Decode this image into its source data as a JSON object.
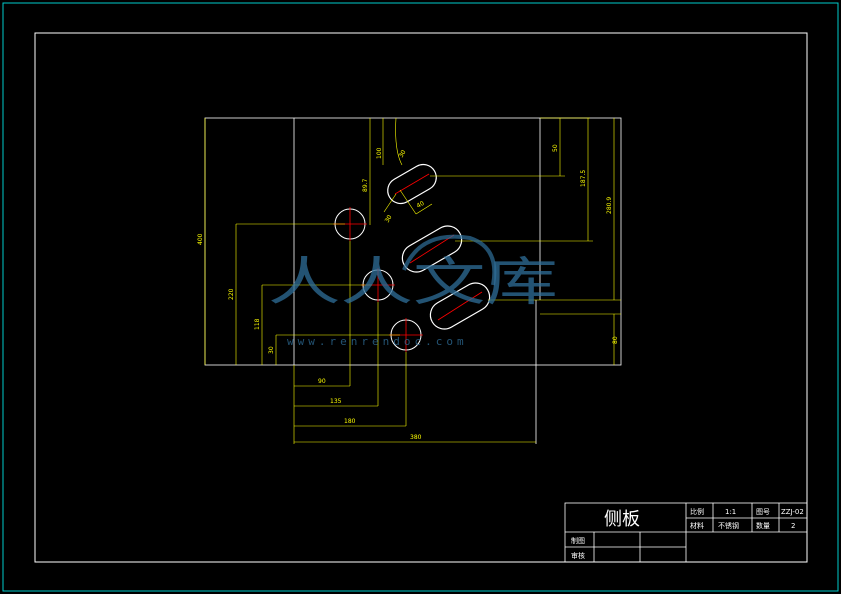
{
  "colors": {
    "background": "#000000",
    "sheet_border": "#00cccc",
    "frame": "#ffffff",
    "part_outline": "#ffffff",
    "dimension": "#ffff00",
    "centerline": "#ff0000",
    "watermark": "#2f6f9a"
  },
  "dimensions": {
    "overall_height": "400",
    "height_hole1": "220",
    "height_hole2": "118",
    "height_hole3": "30",
    "width_hole1": "90",
    "width_hole2": "135",
    "width_hole3": "180",
    "overall_width": "380",
    "top_right_small": "50",
    "top_right_mid": "187.5",
    "right_overall": "280.9",
    "right_bottom": "80",
    "slot_height": "89.7",
    "slot_offset": "100",
    "slot_angle": "30",
    "slot_width": "40"
  },
  "title_block": {
    "part_name": "侧板",
    "scale_label": "比例",
    "scale_value": "1:1",
    "drawing_no_label": "图号",
    "drawing_no_value": "ZZJ-02",
    "material_label": "材料",
    "material_value": "不锈钢",
    "quantity_label": "数量",
    "quantity_value": "2",
    "drawn_label": "制图",
    "checked_label": "审核"
  },
  "watermark": {
    "text": "人人文库",
    "url": "www.renrendoc.com"
  }
}
